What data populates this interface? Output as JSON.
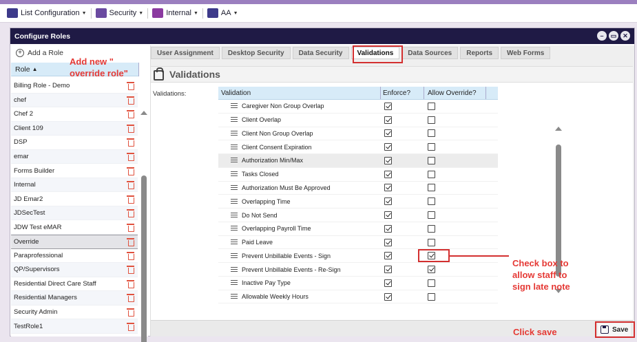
{
  "topbar": {
    "menus": [
      {
        "label": "List Configuration",
        "icon": "list-config-icon",
        "color": "#3d3a8a"
      },
      {
        "label": "Security",
        "icon": "security-icon",
        "color": "#6a4aa0"
      },
      {
        "label": "Internal",
        "icon": "internal-icon",
        "color": "#8b3aa0"
      },
      {
        "label": "AA",
        "icon": "user-icon",
        "color": "#3d3a8a"
      }
    ]
  },
  "dialog": {
    "title": "Configure Roles"
  },
  "left": {
    "add_role_label": "Add a Role",
    "role_header": "Role",
    "roles": [
      "Billing Role - Demo",
      "chef",
      "Chef 2",
      "Client 109",
      "DSP",
      "emar",
      "Forms Builder",
      "Internal",
      "JD Emar2",
      "JDSecTest",
      "JDW Test eMAR",
      "Override",
      "Paraprofessional",
      "QP/Supervisors",
      "Residential Direct Care Staff",
      "Residential Managers",
      "Security Admin",
      "TestRole1"
    ],
    "selected_role": "Override"
  },
  "annotations": {
    "add_override_line1": "Add new \"",
    "add_override_line2": "override role\"",
    "check_box_line1": "Check box to",
    "check_box_line2": "allow staff to",
    "check_box_line3": "sign late note",
    "click_save": "Click save"
  },
  "tabs": [
    "User Assignment",
    "Desktop Security",
    "Data Security",
    "Validations",
    "Data Sources",
    "Reports",
    "Web Forms"
  ],
  "active_tab": "Validations",
  "section": {
    "title": "Validations",
    "label": "Validations:"
  },
  "grid": {
    "headers": [
      "Validation",
      "Enforce?",
      "Allow Override?"
    ],
    "rows": [
      {
        "name": "Caregiver Non Group Overlap",
        "enforce": true,
        "override": false
      },
      {
        "name": "Client Overlap",
        "enforce": true,
        "override": false
      },
      {
        "name": "Client Non Group Overlap",
        "enforce": true,
        "override": false
      },
      {
        "name": "Client Consent Expiration",
        "enforce": true,
        "override": false
      },
      {
        "name": "Authorization Min/Max",
        "enforce": true,
        "override": false
      },
      {
        "name": "Tasks Closed",
        "enforce": true,
        "override": false
      },
      {
        "name": "Authorization Must Be Approved",
        "enforce": true,
        "override": false
      },
      {
        "name": "Overlapping Time",
        "enforce": true,
        "override": false
      },
      {
        "name": "Do Not Send",
        "enforce": true,
        "override": false
      },
      {
        "name": "Overlapping Payroll Time",
        "enforce": true,
        "override": false
      },
      {
        "name": "Paid Leave",
        "enforce": true,
        "override": false
      },
      {
        "name": "Prevent Unbillable Events - Sign",
        "enforce": true,
        "override": true
      },
      {
        "name": "Prevent Unbillable Events - Re-Sign",
        "enforce": true,
        "override": true
      },
      {
        "name": "Inactive Pay Type",
        "enforce": true,
        "override": false
      },
      {
        "name": "Allowable Weekly Hours",
        "enforce": true,
        "override": false
      }
    ]
  },
  "footer": {
    "save_label": "Save"
  }
}
